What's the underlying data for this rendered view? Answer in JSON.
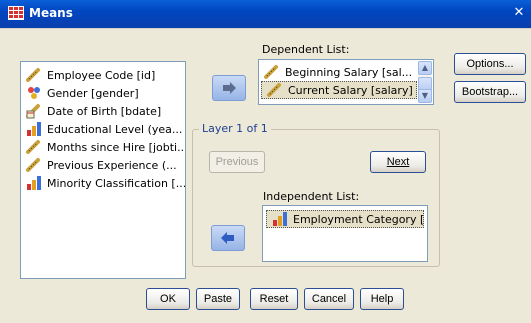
{
  "window": {
    "title": "Means"
  },
  "source_list": {
    "items": [
      {
        "label": "Employee Code [id]",
        "icon": "ruler-icon"
      },
      {
        "label": "Gender [gender]",
        "icon": "nominal-icon"
      },
      {
        "label": "Date of Birth [bdate]",
        "icon": "date-icon"
      },
      {
        "label": "Educational Level (yea...",
        "icon": "ordinal-icon"
      },
      {
        "label": "Months since Hire [jobti...",
        "icon": "ruler-icon"
      },
      {
        "label": "Previous Experience (...",
        "icon": "ruler-icon"
      },
      {
        "label": "Minority Classification [...",
        "icon": "ordinal-icon"
      }
    ]
  },
  "dependent": {
    "label": "Dependent List:",
    "items": [
      {
        "label": "Beginning Salary [sal...",
        "icon": "ruler-icon"
      },
      {
        "label": "Current Salary [salary]",
        "icon": "ruler-icon"
      }
    ]
  },
  "layer": {
    "title": "Layer 1 of 1",
    "previous": "Previous",
    "next": "Next"
  },
  "independent": {
    "label": "Independent List:",
    "items": [
      {
        "label": "Employment Category [...",
        "icon": "ordinal-icon"
      }
    ]
  },
  "side_buttons": {
    "options": "Options...",
    "bootstrap": "Bootstrap..."
  },
  "bottom_buttons": {
    "ok": "OK",
    "paste": "Paste",
    "reset": "Reset",
    "cancel": "Cancel",
    "help": "Help"
  },
  "colors": {
    "titlebar": "#0a49c4",
    "accent": "#1f3f92"
  }
}
